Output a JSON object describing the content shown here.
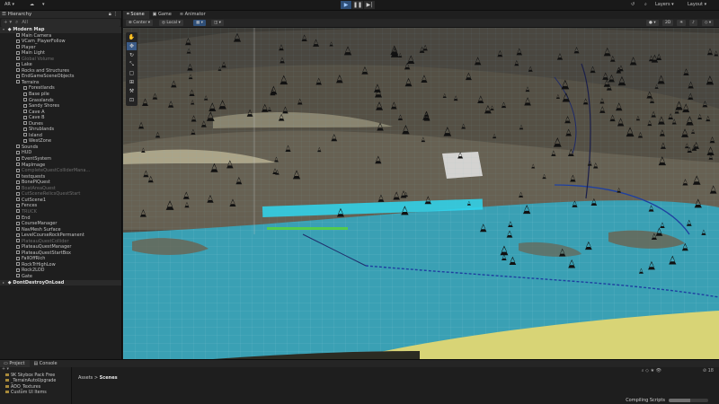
{
  "toolbar": {
    "account": "AR",
    "layers": "Layers",
    "layout": "Layout",
    "play_icon": "play-icon",
    "pause_icon": "pause-icon",
    "step_icon": "step-icon"
  },
  "hierarchy": {
    "tab": "Hierarchy",
    "search_placeholder": "All",
    "scene_root": "Modern Map",
    "items": [
      {
        "label": "Main Camera",
        "depth": 1,
        "dim": false
      },
      {
        "label": "VCam_PlayerFollow",
        "depth": 1,
        "dim": false
      },
      {
        "label": "Player",
        "depth": 1,
        "dim": false
      },
      {
        "label": "Main Light",
        "depth": 1,
        "dim": false
      },
      {
        "label": "Global Volume",
        "depth": 1,
        "dim": true
      },
      {
        "label": "Lake",
        "depth": 1,
        "dim": false
      },
      {
        "label": "Rocks and Structures",
        "depth": 1,
        "dim": false
      },
      {
        "label": "EndGameSceneObjects",
        "depth": 1,
        "dim": false
      },
      {
        "label": "Terrains",
        "depth": 1,
        "dim": false
      },
      {
        "label": "Forestlands",
        "depth": 2,
        "dim": false
      },
      {
        "label": "Base pile",
        "depth": 2,
        "dim": false
      },
      {
        "label": "Grasslands",
        "depth": 2,
        "dim": false
      },
      {
        "label": "Sandy Shores",
        "depth": 2,
        "dim": false
      },
      {
        "label": "Cave A",
        "depth": 2,
        "dim": false
      },
      {
        "label": "Cave B",
        "depth": 2,
        "dim": false
      },
      {
        "label": "Dunes",
        "depth": 2,
        "dim": false
      },
      {
        "label": "Shrublands",
        "depth": 2,
        "dim": false
      },
      {
        "label": "Island",
        "depth": 2,
        "dim": false
      },
      {
        "label": "WestZone",
        "depth": 2,
        "dim": false
      },
      {
        "label": "Sounds",
        "depth": 1,
        "dim": false
      },
      {
        "label": "HUD",
        "depth": 1,
        "dim": false
      },
      {
        "label": "EventSystem",
        "depth": 1,
        "dim": false
      },
      {
        "label": "MapImage",
        "depth": 1,
        "dim": false
      },
      {
        "label": "CompleteQuestColliderMana...",
        "depth": 1,
        "dim": true
      },
      {
        "label": "testquests",
        "depth": 1,
        "dim": false
      },
      {
        "label": "BonePiQuest",
        "depth": 1,
        "dim": false
      },
      {
        "label": "BoatAreaQuest",
        "depth": 1,
        "dim": true
      },
      {
        "label": "CutSceneRelicsQuestStart",
        "depth": 1,
        "dim": true
      },
      {
        "label": "CutScene1",
        "depth": 1,
        "dim": false
      },
      {
        "label": "Fences",
        "depth": 1,
        "dim": false
      },
      {
        "label": "TRUCK",
        "depth": 1,
        "dim": true
      },
      {
        "label": "End",
        "depth": 1,
        "dim": false
      },
      {
        "label": "CourseManager",
        "depth": 1,
        "dim": false
      },
      {
        "label": "NavMesh Surface",
        "depth": 1,
        "dim": false
      },
      {
        "label": "LevelCourseRockPermanent",
        "depth": 1,
        "dim": false
      },
      {
        "label": "PlateauQuestCollider",
        "depth": 1,
        "dim": true
      },
      {
        "label": "PlateauQuestManager",
        "depth": 1,
        "dim": false
      },
      {
        "label": "PlateauQuestStartBox",
        "depth": 1,
        "dim": false
      },
      {
        "label": "FallOffRich",
        "depth": 1,
        "dim": false
      },
      {
        "label": "RockTrHighLow",
        "depth": 1,
        "dim": false
      },
      {
        "label": "Rock2LOD",
        "depth": 1,
        "dim": false
      },
      {
        "label": "Gate",
        "depth": 1,
        "dim": false
      }
    ],
    "dontdestroy": "DontDestroyOnLoad"
  },
  "scene_tabs": [
    "Scene",
    "Game",
    "Animator"
  ],
  "scene_toolbar": {
    "pivot": "Center",
    "space": "Local",
    "mode_2d": "2D"
  },
  "bottom": {
    "tabs": [
      "Project",
      "Console"
    ],
    "tree": [
      "9K Skybox Pack Free",
      "_TerrainAutoUpgrade",
      "ADO_Textures",
      "Custom UI Items"
    ],
    "crumb_root": "Assets",
    "crumb_sep": ">",
    "crumb_current": "Scenes",
    "status": "Compiling Scripts",
    "progress": 0.55
  },
  "colors": {
    "water": "#3aa0b4",
    "selection": "#2fd7f0",
    "accent": "#3a5a86",
    "sand": "#d8d476"
  }
}
